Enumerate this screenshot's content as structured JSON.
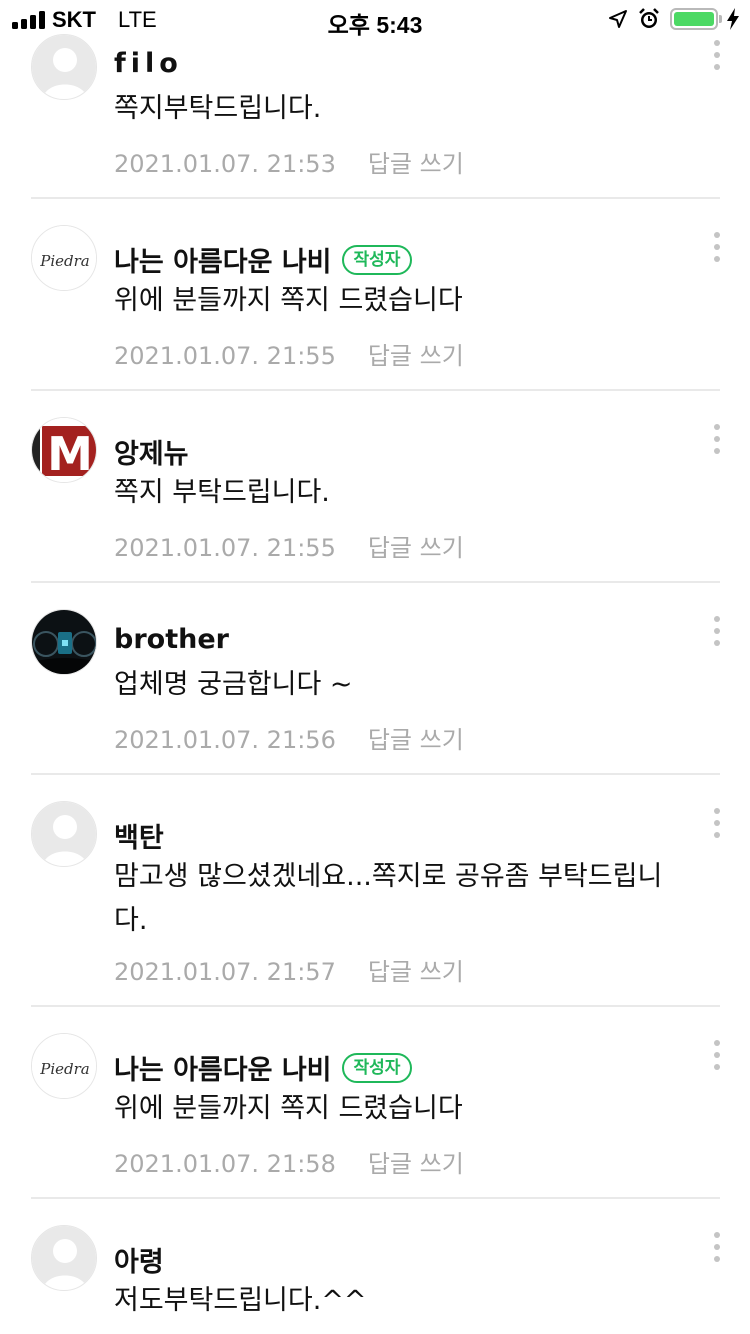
{
  "status_bar": {
    "carrier": "SKT",
    "network": "LTE",
    "time": "오후 5:43",
    "battery_color": "#4cd964"
  },
  "comments": [
    {
      "avatar": "default-avatar",
      "name": "filo",
      "is_author": false,
      "text": "쪽지부탁드립니다.",
      "date": "2021.01.07. 21:53",
      "reply": "답글 쓰기"
    },
    {
      "avatar": "piedra-logo-avatar",
      "avatar_text": "Piedra",
      "name": "나는 아름다운 나비",
      "is_author": true,
      "badge": "작성자",
      "text": "위에 분들까지 쪽지 드렸습니다",
      "date": "2021.01.07. 21:55",
      "reply": "답글 쓰기"
    },
    {
      "avatar": "m-logo-avatar",
      "avatar_text": "M",
      "name": "앙제뉴",
      "is_author": false,
      "text": "쪽지 부탁드립니다.",
      "date": "2021.01.07. 21:55",
      "reply": "답글 쓰기"
    },
    {
      "avatar": "car-dashboard-avatar",
      "name": "brother",
      "is_author": false,
      "text": "업체명 궁금합니다 ~",
      "date": "2021.01.07. 21:56",
      "reply": "답글 쓰기"
    },
    {
      "avatar": "default-avatar",
      "name": "백탄",
      "is_author": false,
      "text": "맘고생 많으셨겠네요...쪽지로 공유좀 부탁드립니다.",
      "date": "2021.01.07. 21:57",
      "reply": "답글 쓰기"
    },
    {
      "avatar": "piedra-logo-avatar",
      "avatar_text": "Piedra",
      "name": "나는 아름다운 나비",
      "is_author": true,
      "badge": "작성자",
      "text": "위에 분들까지 쪽지 드렸습니다",
      "date": "2021.01.07. 21:58",
      "reply": "답글 쓰기"
    },
    {
      "avatar": "default-avatar",
      "name": "아령",
      "is_author": false,
      "text": "저도부탁드립니다.^^",
      "date": "",
      "reply": ""
    }
  ],
  "accent_color": "#1fb85a"
}
